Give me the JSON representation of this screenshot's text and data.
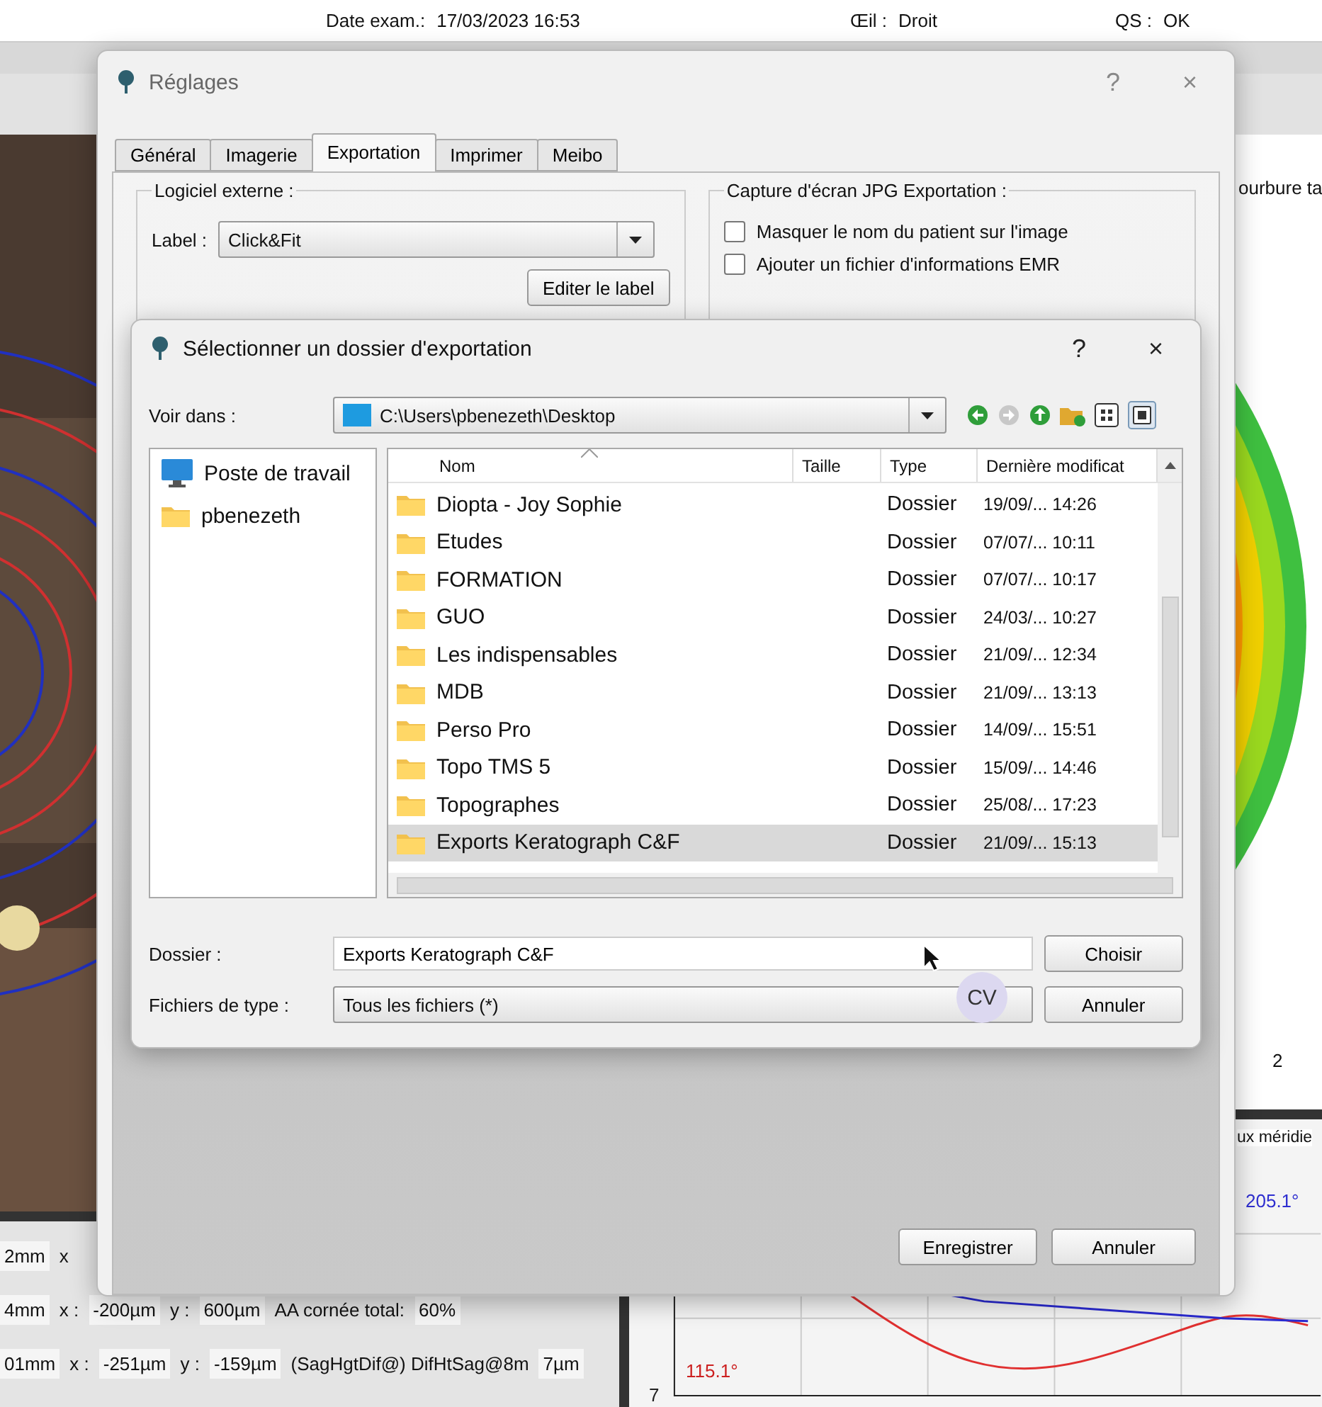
{
  "app_header": {
    "fields": [
      {
        "label": "Date exam.:",
        "value": "17/03/2023 16:53"
      },
      {
        "label": "Œil :",
        "value": "Droit"
      },
      {
        "label": "QS :",
        "value": "OK"
      }
    ]
  },
  "right_panel": {
    "title": "ourbure ta",
    "axis_tick": "2",
    "meridian_title": "ux méridie"
  },
  "meridian_chart": {
    "labels": [
      {
        "text": "205.1°",
        "color": "#2f2fd0"
      },
      {
        "text": "115.1°",
        "color": "#cc2020"
      }
    ],
    "axis_tick": "7"
  },
  "data_rows": [
    [
      {
        "kind": "field",
        "text": "2mm"
      },
      {
        "kind": "label",
        "text": "x"
      }
    ],
    [
      {
        "kind": "field",
        "text": "4mm"
      },
      {
        "kind": "label",
        "text": "x :"
      },
      {
        "kind": "field",
        "text": "-200µm"
      },
      {
        "kind": "label",
        "text": "y :"
      },
      {
        "kind": "field",
        "text": "600µm"
      },
      {
        "kind": "label",
        "text": "AA cornée total:"
      },
      {
        "kind": "field",
        "text": "60%"
      }
    ],
    [
      {
        "kind": "field",
        "text": "01mm"
      },
      {
        "kind": "label",
        "text": "x :"
      },
      {
        "kind": "field",
        "text": "-251µm"
      },
      {
        "kind": "label",
        "text": "y :"
      },
      {
        "kind": "field",
        "text": "-159µm"
      },
      {
        "kind": "label",
        "text": "(SagHgtDif@) DifHtSag@8m"
      },
      {
        "kind": "field",
        "text": "7µm"
      }
    ]
  ],
  "settings_dialog": {
    "title": "Réglages",
    "help": "?",
    "close": "×",
    "tabs": [
      {
        "label": "Général",
        "selected": false
      },
      {
        "label": "Imagerie",
        "selected": false
      },
      {
        "label": "Exportation",
        "selected": true
      },
      {
        "label": "Imprimer",
        "selected": false
      },
      {
        "label": "Meibo",
        "selected": false
      }
    ],
    "external_group": {
      "title": "Logiciel externe :",
      "label": "Label :",
      "value": "Click&Fit",
      "button": "Editer le label"
    },
    "capture_group": {
      "title": "Capture d'écran JPG Exportation :",
      "options": [
        {
          "label": "Masquer le nom du patient sur l'image",
          "checked": false
        },
        {
          "label": "Ajouter un fichier d'informations EMR",
          "checked": false
        }
      ]
    },
    "buttons": [
      "Enregistrer",
      "Annuler"
    ]
  },
  "folder_dialog": {
    "title": "Sélectionner un dossier d'exportation",
    "help": "?",
    "close": "×",
    "look_in": {
      "label": "Voir dans :",
      "value": "C:\\Users\\pbenezeth\\Desktop"
    },
    "places": [
      {
        "kind": "computer",
        "label": "Poste de travail"
      },
      {
        "kind": "folder",
        "label": "pbenezeth"
      }
    ],
    "columns": [
      "Nom",
      "Taille",
      "Type",
      "Dernière modificat"
    ],
    "rows": [
      {
        "name": "Diopta - Joy Sophie",
        "type": "Dossier",
        "modified": "19/09/... 14:26",
        "selected": false
      },
      {
        "name": "Etudes",
        "type": "Dossier",
        "modified": "07/07/... 10:11",
        "selected": false
      },
      {
        "name": "FORMATION",
        "type": "Dossier",
        "modified": "07/07/... 10:17",
        "selected": false
      },
      {
        "name": "GUO",
        "type": "Dossier",
        "modified": "24/03/... 10:27",
        "selected": false
      },
      {
        "name": "Les indispensables",
        "type": "Dossier",
        "modified": "21/09/... 12:34",
        "selected": false
      },
      {
        "name": "MDB",
        "type": "Dossier",
        "modified": "21/09/... 13:13",
        "selected": false
      },
      {
        "name": "Perso Pro",
        "type": "Dossier",
        "modified": "14/09/... 15:51",
        "selected": false
      },
      {
        "name": "Topo TMS 5",
        "type": "Dossier",
        "modified": "15/09/... 14:46",
        "selected": false
      },
      {
        "name": "Topographes",
        "type": "Dossier",
        "modified": "25/08/... 17:23",
        "selected": false
      },
      {
        "name": "Exports Keratograph C&F",
        "type": "Dossier",
        "modified": "21/09/... 15:13",
        "selected": true
      }
    ],
    "folder_field": {
      "label": "Dossier :",
      "value": "Exports Keratograph C&F"
    },
    "type_field": {
      "label": "Fichiers de type :",
      "value": "Tous les fichiers (*)"
    },
    "buttons": [
      "Choisir",
      "Annuler"
    ]
  },
  "avatar_badge": "CV"
}
